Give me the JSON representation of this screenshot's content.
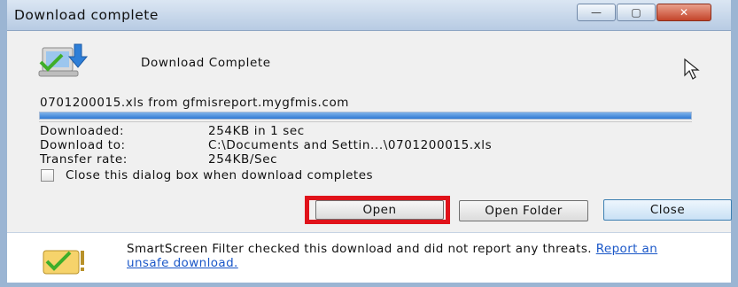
{
  "window": {
    "title": "Download complete",
    "controls": {
      "minimize": "—",
      "maximize": "▢",
      "close": "✕"
    }
  },
  "header": {
    "label": "Download Complete",
    "icon": "download-icon"
  },
  "file": {
    "description": "0701200015.xls from gfmisreport.mygfmis.com",
    "progress_fraction": 1.0
  },
  "details": [
    {
      "label": "Downloaded:",
      "value": "254KB in 1 sec"
    },
    {
      "label": "Download to:",
      "value": "C:\\Documents and Settin...\\0701200015.xls"
    },
    {
      "label": "Transfer rate:",
      "value": "254KB/Sec"
    }
  ],
  "close_on_complete": {
    "label": "Close this dialog box when download completes",
    "checked": false
  },
  "buttons": {
    "open": "Open",
    "open_folder": "Open Folder",
    "close": "Close"
  },
  "footer": {
    "message": "SmartScreen Filter checked this download and did not report any threats.",
    "link": "Report an unsafe download.",
    "icon": "shield-check-icon"
  },
  "colors": {
    "highlight": "#e0121a",
    "progress": "#2f79d3",
    "link": "#1a57c8"
  }
}
